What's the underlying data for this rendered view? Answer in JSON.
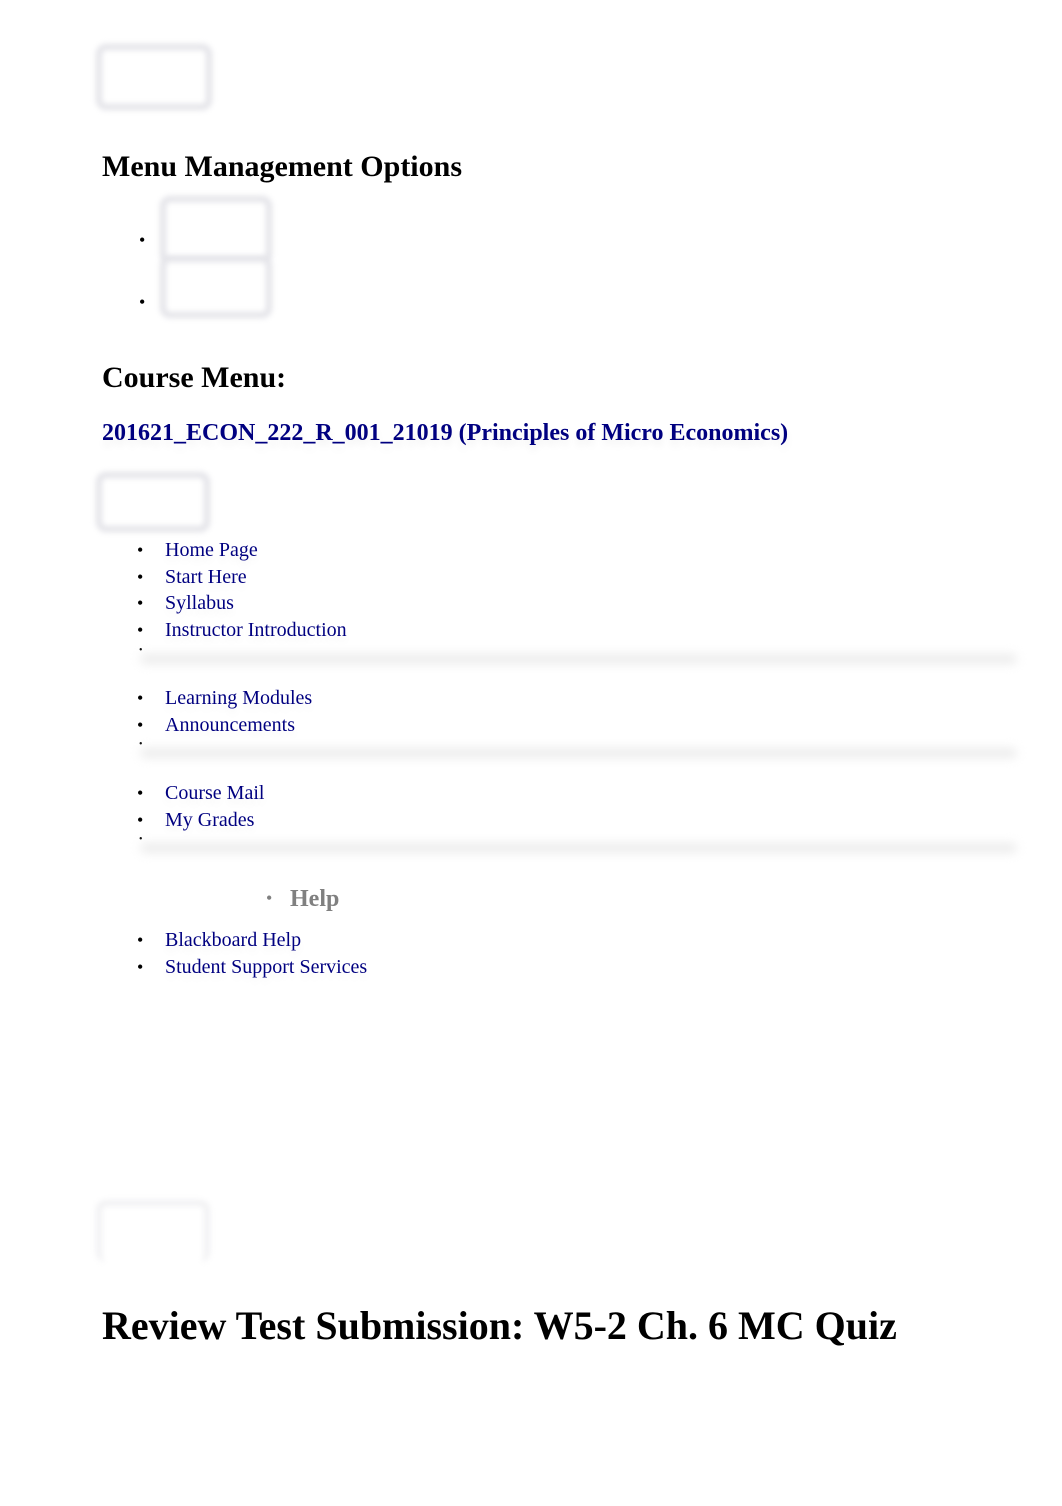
{
  "menu_management": {
    "heading": "Menu Management Options",
    "items": [
      "",
      ""
    ]
  },
  "course_menu": {
    "heading": "Course Menu:",
    "course_title": "201621_ECON_222_R_001_21019 (Principles of Micro Economics)",
    "group1": [
      "Home Page",
      "Start Here",
      "Syllabus",
      "Instructor Introduction"
    ],
    "group2": [
      "Learning Modules",
      "Announcements"
    ],
    "group3": [
      "Course Mail",
      "My Grades"
    ],
    "help_heading": "Help",
    "help_items": [
      "Blackboard Help",
      "Student Support Services"
    ]
  },
  "main": {
    "page_title": "Review Test Submission: W5-2 Ch. 6 MC Quiz"
  },
  "colors": {
    "link": "#000080",
    "help_heading": "#808080"
  }
}
